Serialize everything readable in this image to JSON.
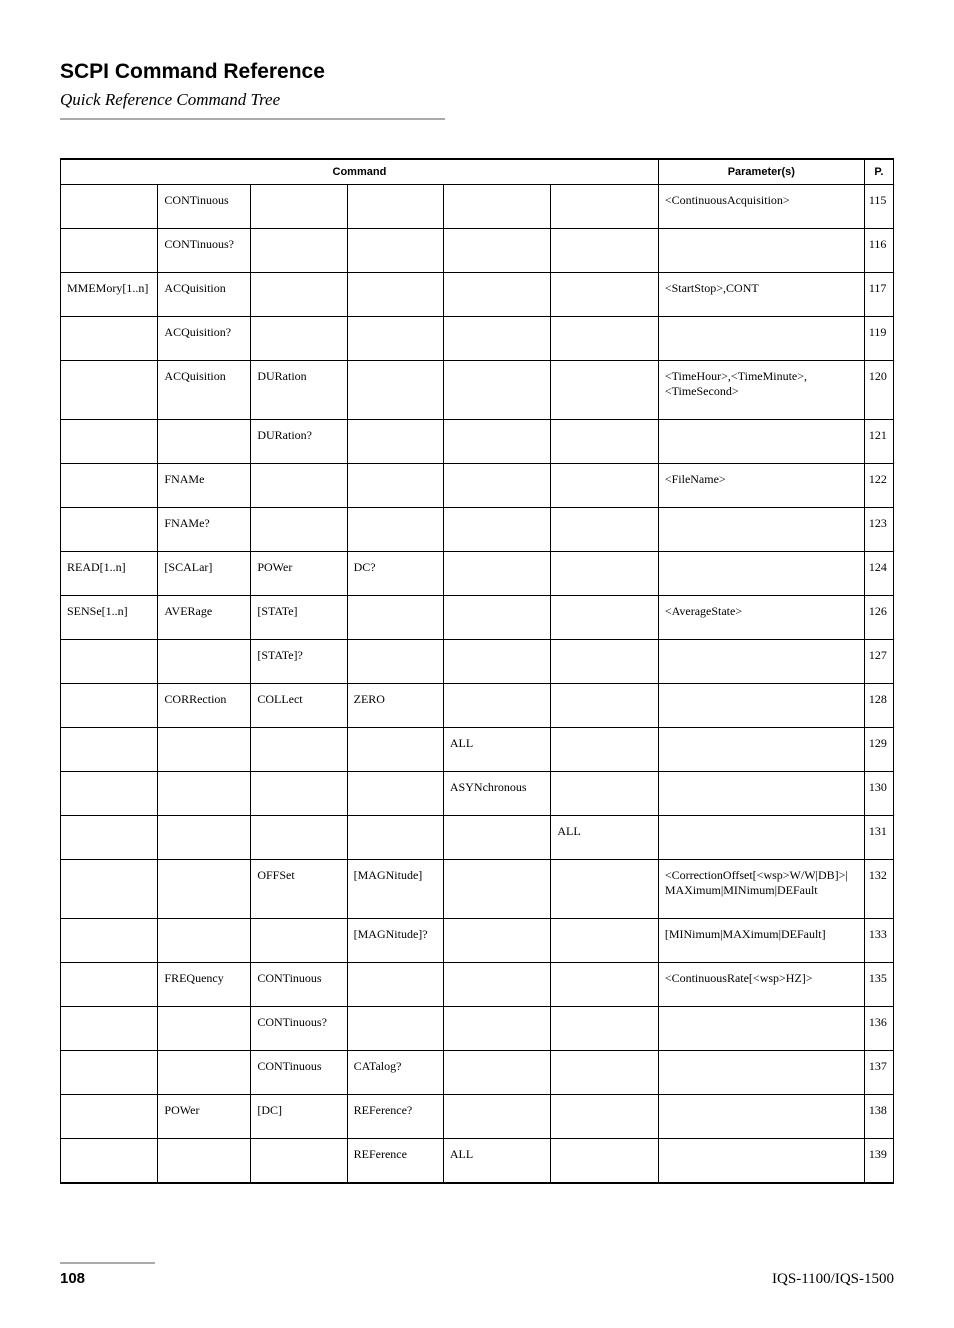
{
  "header": {
    "title": "SCPI Command Reference",
    "subtitle": "Quick Reference Command Tree"
  },
  "table": {
    "headers": {
      "command": "Command",
      "parameters": "Parameter(s)",
      "page": "P."
    },
    "rows": [
      {
        "c": [
          "",
          "CONTinuous",
          "",
          "",
          "",
          ""
        ],
        "p": "<ContinuousAcquisition>",
        "pg": "115"
      },
      {
        "c": [
          "",
          "CONTinuous?",
          "",
          "",
          "",
          ""
        ],
        "p": "",
        "pg": "116"
      },
      {
        "c": [
          "MMEMory[1..n]",
          "ACQuisition",
          "",
          "",
          "",
          ""
        ],
        "p": "<StartStop>,CONT",
        "pg": "117"
      },
      {
        "c": [
          "",
          "ACQuisition?",
          "",
          "",
          "",
          ""
        ],
        "p": "",
        "pg": "119"
      },
      {
        "c": [
          "",
          "ACQuisition",
          "DURation",
          "",
          "",
          ""
        ],
        "p": "<TimeHour>,<TimeMinute>,<TimeSecond>",
        "pg": "120"
      },
      {
        "c": [
          "",
          "",
          "DURation?",
          "",
          "",
          ""
        ],
        "p": "",
        "pg": "121"
      },
      {
        "c": [
          "",
          "FNAMe",
          "",
          "",
          "",
          ""
        ],
        "p": "<FileName>",
        "pg": "122"
      },
      {
        "c": [
          "",
          "FNAMe?",
          "",
          "",
          "",
          ""
        ],
        "p": "",
        "pg": "123"
      },
      {
        "c": [
          "READ[1..n]",
          "[SCALar]",
          "POWer",
          "DC?",
          "",
          ""
        ],
        "p": "",
        "pg": "124"
      },
      {
        "c": [
          "SENSe[1..n]",
          "AVERage",
          "[STATe]",
          "",
          "",
          ""
        ],
        "p": "<AverageState>",
        "pg": "126"
      },
      {
        "c": [
          "",
          "",
          "[STATe]?",
          "",
          "",
          ""
        ],
        "p": "",
        "pg": "127"
      },
      {
        "c": [
          "",
          "CORRection",
          "COLLect",
          "ZERO",
          "",
          ""
        ],
        "p": "",
        "pg": "128"
      },
      {
        "c": [
          "",
          "",
          "",
          "",
          "ALL",
          ""
        ],
        "p": "",
        "pg": "129"
      },
      {
        "c": [
          "",
          "",
          "",
          "",
          "ASYNchronous",
          ""
        ],
        "p": "",
        "pg": "130"
      },
      {
        "c": [
          "",
          "",
          "",
          "",
          "",
          "ALL"
        ],
        "p": "",
        "pg": "131"
      },
      {
        "c": [
          "",
          "",
          "OFFSet",
          "[MAGNitude]",
          "",
          ""
        ],
        "p": "<CorrectionOffset[<wsp>W/W|DB]>|MAXimum|MINimum|DEFault",
        "pg": "132"
      },
      {
        "c": [
          "",
          "",
          "",
          "[MAGNitude]?",
          "",
          ""
        ],
        "p": "[MINimum|MAXimum|DEFault]",
        "pg": "133"
      },
      {
        "c": [
          "",
          "FREQuency",
          "CONTinuous",
          "",
          "",
          ""
        ],
        "p": "<ContinuousRate[<wsp>HZ]>",
        "pg": "135"
      },
      {
        "c": [
          "",
          "",
          "CONTinuous?",
          "",
          "",
          ""
        ],
        "p": "",
        "pg": "136"
      },
      {
        "c": [
          "",
          "",
          "CONTinuous",
          "CATalog?",
          "",
          ""
        ],
        "p": "",
        "pg": "137"
      },
      {
        "c": [
          "",
          "POWer",
          "[DC]",
          "REFerence?",
          "",
          ""
        ],
        "p": "",
        "pg": "138"
      },
      {
        "c": [
          "",
          "",
          "",
          "REFerence",
          "ALL",
          ""
        ],
        "p": "",
        "pg": "139"
      }
    ]
  },
  "footer": {
    "page": "108",
    "model": "IQS-1100/IQS-1500"
  }
}
